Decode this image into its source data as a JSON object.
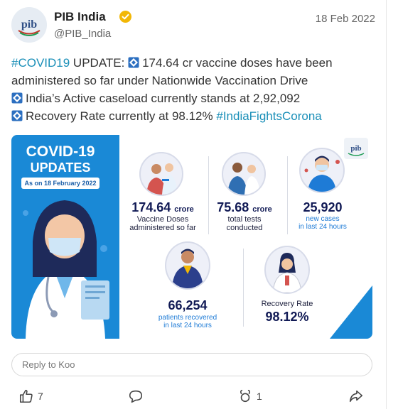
{
  "post": {
    "author_name": "PIB India",
    "author_handle": "@PIB_India",
    "date": "18 Feb 2022",
    "avatar_text": "pib",
    "text": {
      "hashtag_covid": "#COVID19",
      "line1_rest": " UPDATE: ",
      "line1_stat": "174.64 cr vaccine doses have been",
      "line2": "administered so far under Nationwide Vaccination Drive",
      "line3": "India’s Active caseload currently stands at 2,92,092",
      "line4": "Recovery Rate currently at 98.12% ",
      "hashtag_india": "#IndiaFightsCorona"
    }
  },
  "infographic": {
    "title_line1": "COVID-19",
    "title_line2": "UPDATES",
    "as_on": "As on 18 February 2022",
    "logo_text": "pib",
    "stats": {
      "vaccine": {
        "number": "174.64",
        "unit": "crore",
        "label1": "Vaccine Doses",
        "label2": "administered so far"
      },
      "tests": {
        "number": "75.68",
        "unit": "crore",
        "label1": "total tests",
        "label2": "conducted"
      },
      "cases": {
        "number": "25,920",
        "sub1": "new cases",
        "sub2": "in last 24 hours"
      },
      "recovered": {
        "number": "66,254",
        "sub1": "patients recovered",
        "sub2": "in last 24 hours"
      },
      "recovery_rate": {
        "label": "Recovery Rate",
        "number": "98.12%"
      }
    }
  },
  "reply": {
    "placeholder": "Reply to Koo"
  },
  "actions": {
    "likes": "7",
    "rekoos": "1"
  },
  "colors": {
    "hashtag": "#1a8fb8",
    "infographic_blue": "#1a89d6",
    "stat_navy": "#111a55",
    "verified": "#f2b705"
  }
}
